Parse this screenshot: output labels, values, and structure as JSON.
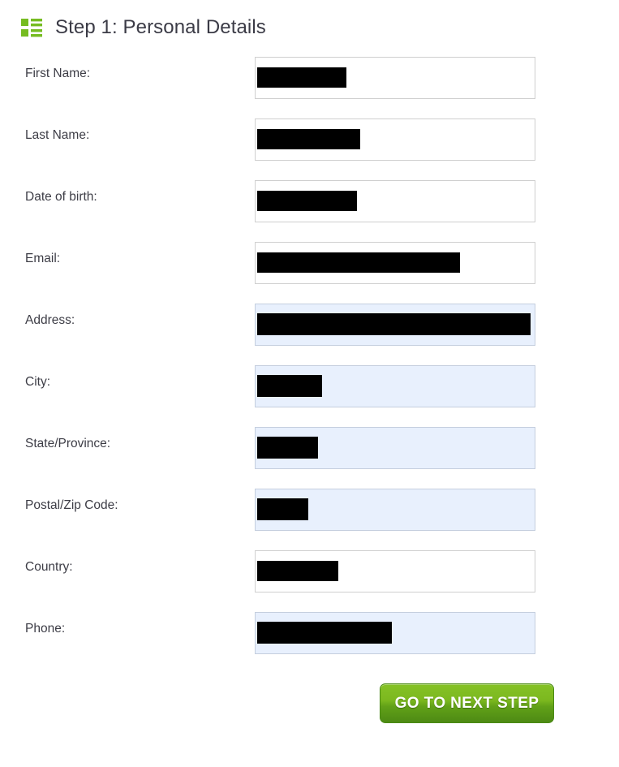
{
  "header": {
    "icon": "list-view-icon",
    "icon_color": "#76bc21",
    "title": "Step 1: Personal Details"
  },
  "form": {
    "fields": [
      {
        "label": "First Name:",
        "name": "first-name",
        "autofilled": false,
        "value": "",
        "redaction_width": 110
      },
      {
        "label": "Last Name:",
        "name": "last-name",
        "autofilled": false,
        "value": "",
        "redaction_width": 127
      },
      {
        "label": "Date of birth:",
        "name": "date-of-birth",
        "autofilled": false,
        "value": "",
        "redaction_width": 123
      },
      {
        "label": "Email:",
        "name": "email",
        "autofilled": false,
        "value": "",
        "redaction_width": 250
      },
      {
        "label": "Address:",
        "name": "address",
        "autofilled": true,
        "value": "",
        "redaction_width": 337
      },
      {
        "label": "City:",
        "name": "city",
        "autofilled": true,
        "value": "",
        "redaction_width": 80
      },
      {
        "label": "State/Province:",
        "name": "state-province",
        "autofilled": true,
        "value": "",
        "redaction_width": 75
      },
      {
        "label": "Postal/Zip Code:",
        "name": "postal-zip-code",
        "autofilled": true,
        "value": "",
        "redaction_width": 63
      },
      {
        "label": "Country:",
        "name": "country",
        "autofilled": false,
        "value": "",
        "redaction_width": 100
      },
      {
        "label": "Phone:",
        "name": "phone",
        "autofilled": true,
        "value": "",
        "redaction_width": 166
      }
    ]
  },
  "actions": {
    "next_step_label": "Go to next step"
  },
  "colors": {
    "accent_green": "#76bc21",
    "button_green_top": "#85c226",
    "button_green_bottom": "#4d8a14",
    "autofill_background": "#e8f0fd",
    "input_border": "#cfcfcf",
    "text": "#3d3d46"
  }
}
